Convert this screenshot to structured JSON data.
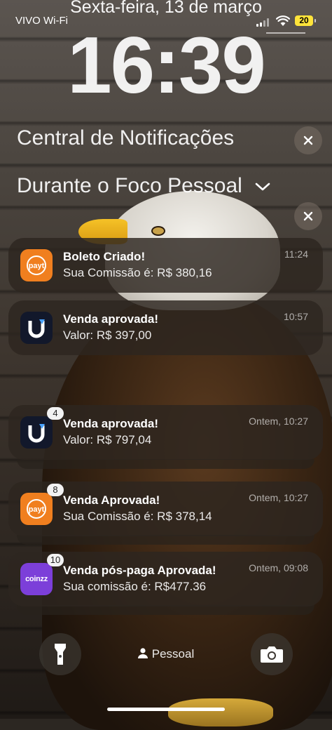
{
  "status_bar": {
    "carrier": "VIVO Wi-Fi",
    "date": "Sexta-feira, 13 de março",
    "battery": "20",
    "battery_color": "#ffe43a"
  },
  "clock": "16:39",
  "notification_center": {
    "title": "Central de Notificações"
  },
  "focus_section": {
    "title": "Durante o Foco Pessoal"
  },
  "notifications": [
    {
      "app": "payt",
      "icon": "payt-icon",
      "title": "Boleto Criado!",
      "body": "Sua Comissão é: R$ 380,16",
      "time": "11:24",
      "badge": ""
    },
    {
      "app": "u",
      "icon": "u-app-icon",
      "title": "Venda aprovada!",
      "body": "Valor: R$ 397,00",
      "time": "10:57",
      "badge": ""
    },
    {
      "app": "u",
      "icon": "u-app-icon",
      "title": "Venda aprovada!",
      "body": "Valor: R$ 797,04",
      "time": "Ontem, 10:27",
      "badge": "4"
    },
    {
      "app": "payt",
      "icon": "payt-icon",
      "title": "Venda Aprovada!",
      "body": "Sua Comissão é: R$ 378,14",
      "time": "Ontem, 10:27",
      "badge": "8"
    },
    {
      "app": "coinzz",
      "icon": "coinzz-icon",
      "icon_text": "coinzz",
      "title": "Venda pós-paga Aprovada!",
      "body": "Sua comissão é: R$477.36",
      "time": "Ontem, 09:08",
      "badge": "10"
    }
  ],
  "bottom": {
    "focus_label": "Pessoal",
    "flashlight_icon": "flashlight-icon",
    "camera_icon": "camera-icon"
  },
  "colors": {
    "payt": "#f07f1f",
    "u_app": "#12182b",
    "coinzz": "#7c3fd9"
  }
}
